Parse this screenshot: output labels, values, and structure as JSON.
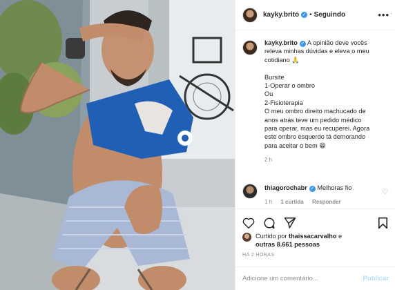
{
  "post": {
    "username": "kayky.brito",
    "follow_separator": "•",
    "follow_status": "Seguindo",
    "more_label": "•••"
  },
  "caption": {
    "username": "kayky.brito",
    "lines": [
      "A opinião deve vocês",
      "releva minhas dúvidas e eleva o meu",
      "cotidiano 🙏",
      "",
      "Bursite",
      "1-Operar o ombro",
      "Ou",
      "2-Fisioterapia",
      "O meu ombro direito machucado de",
      "anos atrás teve um pedido médico",
      "para operar, mas eu recuperei. Agora",
      "este ombro esquerdo tá demorando",
      "para aceitar o bem 😁"
    ],
    "time": "2 h"
  },
  "reply": {
    "username": "thiagorochabr",
    "text": "Melhoras fio",
    "time": "1 h",
    "likes": "1 curtida",
    "reply_label": "Responder"
  },
  "likes": {
    "prefix": "Curtido por",
    "user": "thaissacarvalho",
    "connector": "e",
    "others": "outras 8.661 pessoas"
  },
  "posted_ago": "HÁ 2 HORAS",
  "comment_box": {
    "placeholder": "Adicione um comentário...",
    "publish_label": "Publicar"
  },
  "icons": {
    "heart": "heart-icon",
    "comment": "comment-icon",
    "share": "share-icon",
    "bookmark": "bookmark-icon"
  },
  "colors": {
    "verified": "#3897f0",
    "publish_disabled": "#b2dffc",
    "muted": "#8e8e8e"
  }
}
